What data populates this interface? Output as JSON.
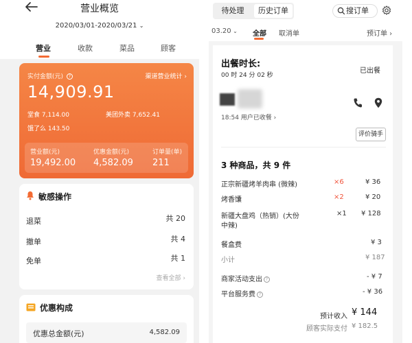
{
  "left": {
    "title": "营业概览",
    "date_range": "2020/03/01-2020/03/21",
    "tabs": [
      "营业",
      "收款",
      "菜品",
      "顾客"
    ],
    "revenue": {
      "actual_label": "实付金额(元)",
      "channel_link": "渠道营业统计",
      "actual_value": "14,909.91",
      "channels": [
        {
          "name": "堂食",
          "value": "7,114.00"
        },
        {
          "name": "美团外卖",
          "value": "7,652.41"
        },
        {
          "name": "饿了么",
          "value": "143.50"
        }
      ],
      "stats": [
        {
          "label": "营业额(元)",
          "value": "19,492.00"
        },
        {
          "label": "优惠金额(元)",
          "value": "4,582.09"
        },
        {
          "label": "订单量(单)",
          "value": "211"
        }
      ]
    },
    "ops": {
      "title": "敏感操作",
      "rows": [
        {
          "label": "退菜",
          "value": "共 20"
        },
        {
          "label": "撤单",
          "value": "共 4"
        },
        {
          "label": "免单",
          "value": "共 1"
        }
      ],
      "view_all": "查看全部"
    },
    "discount": {
      "title": "优惠构成",
      "row_label": "优惠总金额(元)",
      "row_value": "4,582.09"
    }
  },
  "right": {
    "segments": [
      "待处理",
      "历史订单"
    ],
    "search": "搜订单",
    "filters": {
      "date": "03.20",
      "all": "全部",
      "cancel": "取消单",
      "preorder": "预订单"
    },
    "order": {
      "prep_label": "出餐时长:",
      "prep_time": "00 时 24 分 02 秒",
      "status": "已出餐",
      "receipt": "18:54  用户已收餐",
      "rider_button": "评价骑手",
      "summary": "3 种商品，共 9 件",
      "items": [
        {
          "name": "正宗新疆烤羊肉串 (微辣)",
          "qty": "×6",
          "price": "¥ 36",
          "qty_red": true
        },
        {
          "name": "烤香馕",
          "qty": "×2",
          "price": "¥ 20",
          "qty_red": true
        },
        {
          "name": "新疆大盘鸡（热销）(大份",
          "name2": "中辣)",
          "qty": "×1",
          "price": "¥ 128",
          "qty_red": false
        }
      ],
      "box_fee_label": "餐盒费",
      "box_fee": "¥ 3",
      "subtotal_label": "小计",
      "subtotal": "¥ 187",
      "merchant_label": "商家活动支出",
      "merchant": "- ¥ 7",
      "platform_label": "平台服务费",
      "platform": "- ¥ 36",
      "expected_label": "预计收入",
      "expected": "¥ 144",
      "paid_label": "顾客实际支付",
      "paid": "¥ 182.5"
    }
  },
  "colors": {
    "accent": "#f36b33",
    "red": "#f0533a"
  }
}
